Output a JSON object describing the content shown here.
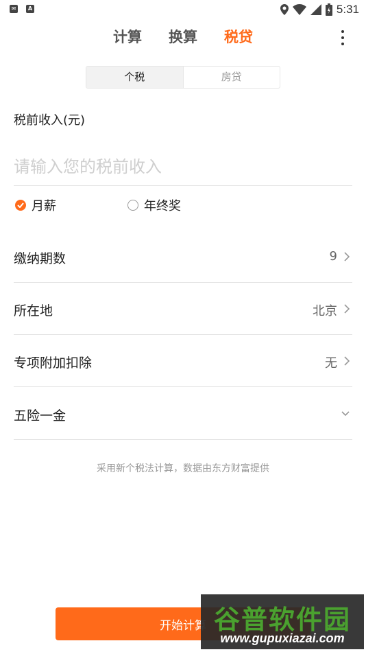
{
  "status_bar": {
    "left_icons": [
      "mail-icon",
      "a-icon"
    ],
    "time": "5:31"
  },
  "nav": {
    "tabs": [
      {
        "label": "计算",
        "active": false
      },
      {
        "label": "换算",
        "active": false
      },
      {
        "label": "税贷",
        "active": true
      }
    ]
  },
  "segment": {
    "items": [
      {
        "label": "个税",
        "active": true
      },
      {
        "label": "房贷",
        "active": false
      }
    ]
  },
  "income": {
    "label": "税前收入(元)",
    "placeholder": "请输入您的税前收入",
    "value": ""
  },
  "radio": {
    "monthly": "月薪",
    "annual_bonus": "年终奖",
    "selected": "monthly"
  },
  "rows": [
    {
      "label": "缴纳期数",
      "value": "9",
      "icon": "chevron-right-icon"
    },
    {
      "label": "所在地",
      "value": "北京",
      "icon": "chevron-right-icon"
    },
    {
      "label": "专项附加扣除",
      "value": "无",
      "icon": "chevron-right-icon"
    },
    {
      "label": "五险一金",
      "value": "",
      "icon": "chevron-down-icon"
    }
  ],
  "note": "采用新个税法计算，数据由东方财富提供",
  "start_button": "开始计算",
  "watermark": {
    "title": "谷普软件园",
    "url": "www.gupuxiazai.com"
  },
  "colors": {
    "accent": "#ff6a1a",
    "watermark_green": "#4aa12f"
  }
}
